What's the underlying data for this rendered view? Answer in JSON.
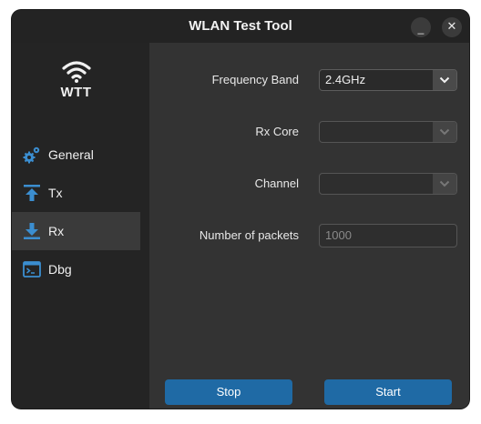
{
  "window": {
    "title": "WLAN Test Tool",
    "minimize_symbol": "_",
    "close_symbol": "✕"
  },
  "sidebar": {
    "logo_text": "WTT",
    "logo_icon": "wifi-icon",
    "items": [
      {
        "label": "General",
        "icon": "gears-icon",
        "active": false
      },
      {
        "label": "Tx",
        "icon": "upload-icon",
        "active": false
      },
      {
        "label": "Rx",
        "icon": "download-icon",
        "active": true
      },
      {
        "label": "Dbg",
        "icon": "terminal-icon",
        "active": false
      }
    ]
  },
  "form": {
    "frequency_band": {
      "label": "Frequency Band",
      "value": "2.4GHz"
    },
    "rx_core": {
      "label": "Rx Core",
      "value": ""
    },
    "channel": {
      "label": "Channel",
      "value": ""
    },
    "packets": {
      "label": "Number of packets",
      "placeholder": "1000"
    }
  },
  "actions": {
    "stop_label": "Stop",
    "start_label": "Start"
  },
  "colors": {
    "accent": "#1f6aa5",
    "nav_icon": "#3b8ed0"
  }
}
